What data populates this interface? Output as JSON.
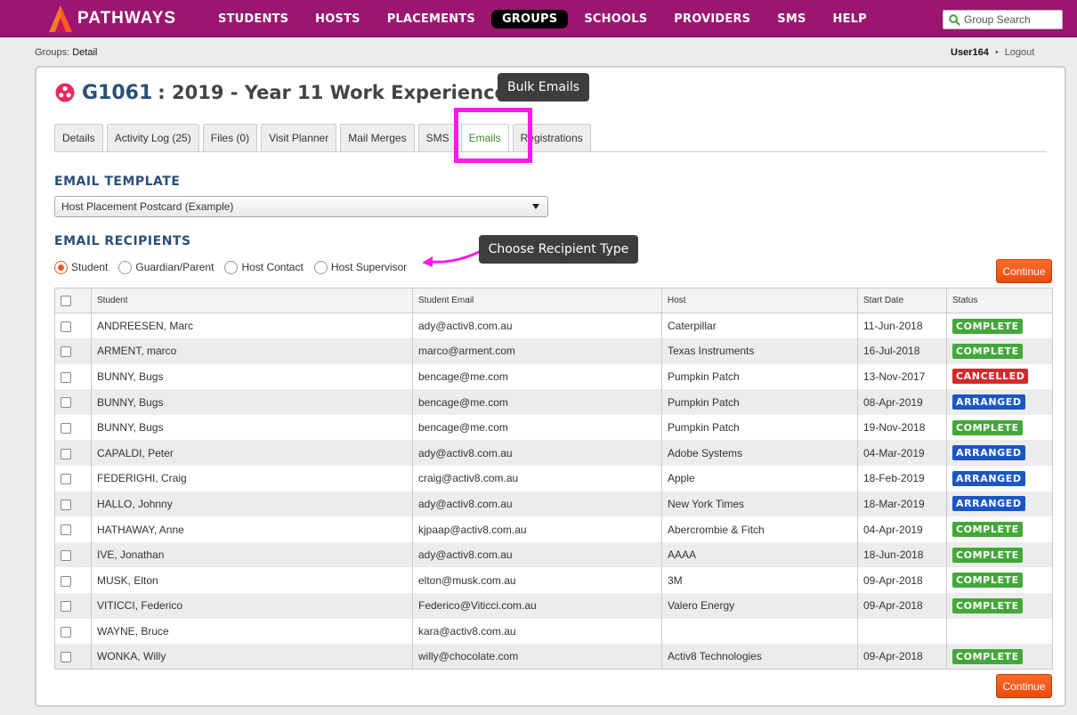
{
  "app": {
    "name": "PATHWAYS"
  },
  "nav": [
    {
      "label": "STUDENTS",
      "active": false
    },
    {
      "label": "HOSTS",
      "active": false
    },
    {
      "label": "PLACEMENTS",
      "active": false
    },
    {
      "label": "GROUPS",
      "active": true
    },
    {
      "label": "SCHOOLS",
      "active": false
    },
    {
      "label": "PROVIDERS",
      "active": false
    },
    {
      "label": "SMS",
      "active": false
    },
    {
      "label": "HELP",
      "active": false
    }
  ],
  "search": {
    "placeholder": "Group Search"
  },
  "breadcrumb": {
    "section": "Groups:",
    "page": "Detail"
  },
  "user": {
    "name": "User164",
    "separator": "•",
    "logout": "Logout"
  },
  "group": {
    "code": "G1061",
    "title": ": 2019 - Year 11 Work Experience"
  },
  "tabs": [
    {
      "label": "Details",
      "active": false
    },
    {
      "label": "Activity Log (25)",
      "active": false
    },
    {
      "label": "Files (0)",
      "active": false
    },
    {
      "label": "Visit Planner",
      "active": false
    },
    {
      "label": "Mail Merges",
      "active": false
    },
    {
      "label": "SMS",
      "active": false
    },
    {
      "label": "Emails",
      "active": true
    },
    {
      "label": "Registrations",
      "active": false
    }
  ],
  "callouts": {
    "bulk_emails": "Bulk Emails",
    "recipient_type": "Choose Recipient Type"
  },
  "template_section": {
    "heading": "EMAIL TEMPLATE",
    "selected": "Host Placement Postcard (Example)"
  },
  "recipients_section": {
    "heading": "EMAIL RECIPIENTS",
    "options": [
      {
        "label": "Student",
        "checked": true
      },
      {
        "label": "Guardian/Parent",
        "checked": false
      },
      {
        "label": "Host Contact",
        "checked": false
      },
      {
        "label": "Host Supervisor",
        "checked": false
      }
    ]
  },
  "continue_label": "Continue",
  "table": {
    "columns": [
      "Student",
      "Student Email",
      "Host",
      "Start Date",
      "Status"
    ],
    "rows": [
      {
        "student": "ANDREESEN, Marc",
        "email": "ady@activ8.com.au",
        "host": "Caterpillar",
        "start": "11-Jun-2018",
        "status": "COMPLETE"
      },
      {
        "student": "ARMENT, marco",
        "email": "marco@arment.com",
        "host": "Texas Instruments",
        "start": "16-Jul-2018",
        "status": "COMPLETE"
      },
      {
        "student": "BUNNY, Bugs",
        "email": "bencage@me.com",
        "host": "Pumpkin Patch",
        "start": "13-Nov-2017",
        "status": "CANCELLED"
      },
      {
        "student": "BUNNY, Bugs",
        "email": "bencage@me.com",
        "host": "Pumpkin Patch",
        "start": "08-Apr-2019",
        "status": "ARRANGED"
      },
      {
        "student": "BUNNY, Bugs",
        "email": "bencage@me.com",
        "host": "Pumpkin Patch",
        "start": "19-Nov-2018",
        "status": "COMPLETE"
      },
      {
        "student": "CAPALDI, Peter",
        "email": "ady@activ8.com.au",
        "host": "Adobe Systems",
        "start": "04-Mar-2019",
        "status": "ARRANGED"
      },
      {
        "student": "FEDERIGHI, Craig",
        "email": "craig@activ8.com.au",
        "host": "Apple",
        "start": "18-Feb-2019",
        "status": "ARRANGED"
      },
      {
        "student": "HALLO, Johnny",
        "email": "ady@activ8.com.au",
        "host": "New York Times",
        "start": "18-Mar-2019",
        "status": "ARRANGED"
      },
      {
        "student": "HATHAWAY, Anne",
        "email": "kjpaap@activ8.com.au",
        "host": "Abercrombie & Fitch",
        "start": "04-Apr-2019",
        "status": "COMPLETE"
      },
      {
        "student": "IVE, Jonathan",
        "email": "ady@activ8.com.au",
        "host": "AAAA",
        "start": "18-Jun-2018",
        "status": "COMPLETE"
      },
      {
        "student": "MUSK, Elton",
        "email": "elton@musk.com.au",
        "host": "3M",
        "start": "09-Apr-2018",
        "status": "COMPLETE"
      },
      {
        "student": "VITICCI, Federico",
        "email": "Federico@Viticci.com.au",
        "host": "Valero Energy",
        "start": "09-Apr-2018",
        "status": "COMPLETE"
      },
      {
        "student": "WAYNE, Bruce",
        "email": "kara@activ8.com.au",
        "host": "",
        "start": "",
        "status": ""
      },
      {
        "student": "WONKA, Willy",
        "email": "willy@chocolate.com",
        "host": "Activ8 Technologies",
        "start": "09-Apr-2018",
        "status": "COMPLETE"
      }
    ]
  },
  "colors": {
    "topbar": "#9b1670",
    "accent": "#f05a22",
    "heading": "#2a4f7a",
    "highlight": "#ff19ee",
    "COMPLETE": "#43a83a",
    "CANCELLED": "#d32b2b",
    "ARRANGED": "#1a56c4"
  }
}
